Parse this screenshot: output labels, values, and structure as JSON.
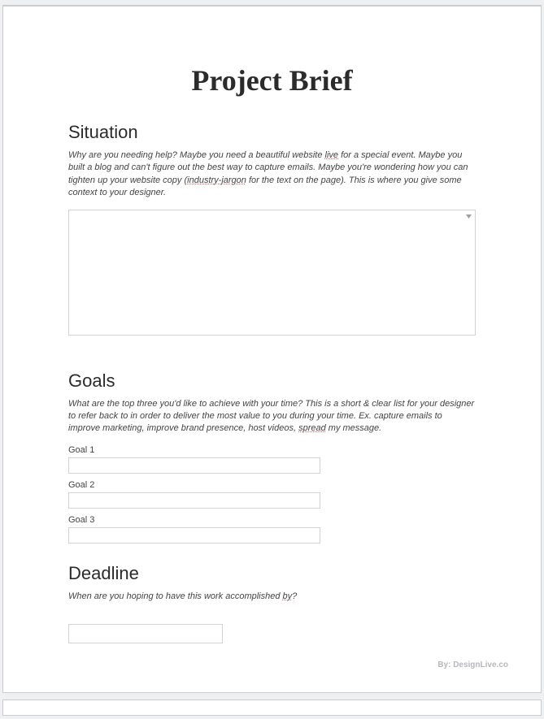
{
  "title": "Project Brief",
  "situation": {
    "heading": "Situation",
    "prompt_pre": "Why are you needing help? Maybe you need a beautiful website ",
    "prompt_err1": "live",
    "prompt_mid": " for a special event. Maybe you built a blog and can't figure out the best way to capture emails. Maybe you're wondering how you can tighten up your website copy (",
    "prompt_err2": "industry-jargon",
    "prompt_post": " for the text on the page). This is where you give some context to your designer.",
    "value": ""
  },
  "goals": {
    "heading": "Goals",
    "prompt_pre": "What are the top three you'd like to achieve with your time? This is a short & clear list for your designer to refer back to in order to deliver the most value to you during your time. Ex. capture emails to improve marketing, improve brand presence, host videos, ",
    "prompt_err1": "spread",
    "prompt_post": " my message.",
    "items": [
      {
        "label": "Goal 1",
        "value": ""
      },
      {
        "label": "Goal 2",
        "value": ""
      },
      {
        "label": "Goal 3",
        "value": ""
      }
    ]
  },
  "deadline": {
    "heading": "Deadline",
    "prompt_pre": "When are you hoping to have this work accomplished ",
    "prompt_err1": "by",
    "prompt_post": "?",
    "value": ""
  },
  "byline": "By: DesignLive.co"
}
